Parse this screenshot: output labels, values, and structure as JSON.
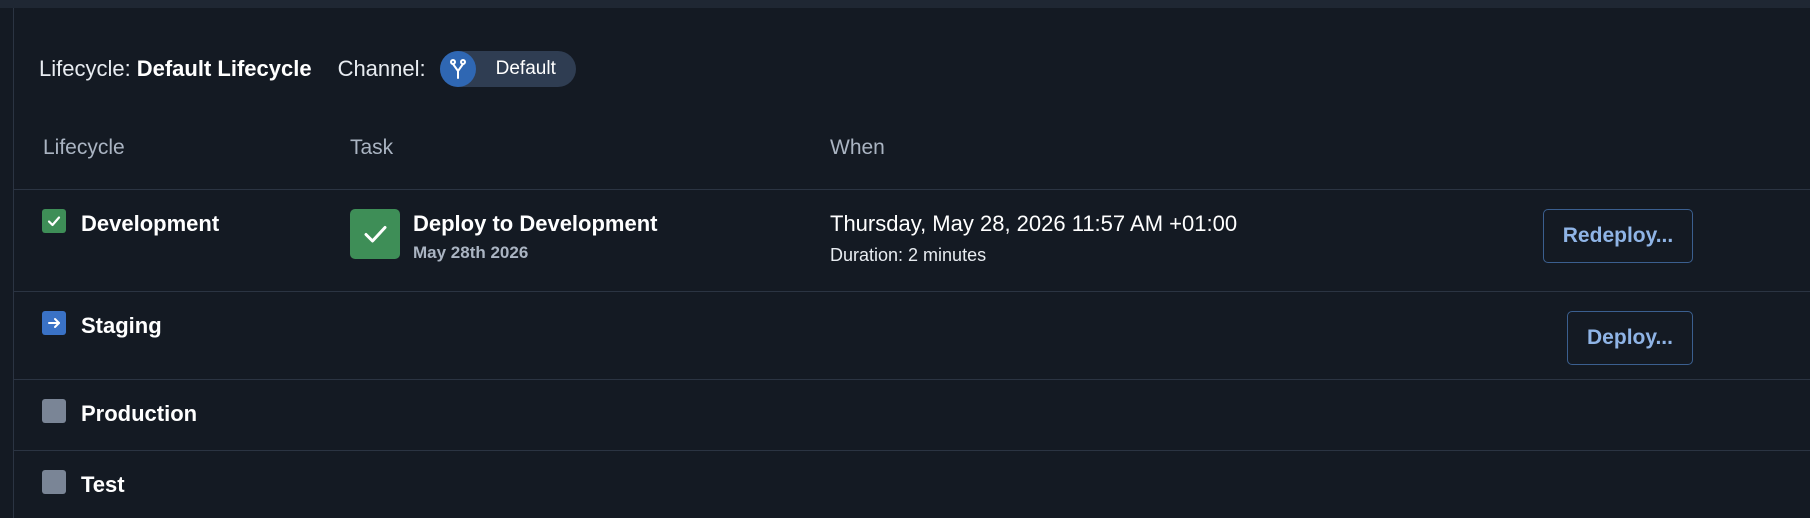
{
  "summary": {
    "lifecycle_label": "Lifecycle:",
    "lifecycle_value": "Default Lifecycle",
    "channel_label": "Channel:",
    "channel_value": "Default",
    "channel_icon": "branch-icon"
  },
  "columns": [
    "Lifecycle",
    "Task",
    "When"
  ],
  "rows": [
    {
      "stage": "Development",
      "status": "done",
      "status_icon": "checkmark-icon",
      "task_title": "Deploy to Development",
      "task_date": "May 28th 2026",
      "when": "Thursday, May 28, 2026 11:57 AM +01:00",
      "duration": "Duration: 2 minutes",
      "action": "Redeploy..."
    },
    {
      "stage": "Staging",
      "status": "next",
      "status_icon": "arrow-right-icon",
      "action": "Deploy..."
    },
    {
      "stage": "Production",
      "status": "todo"
    },
    {
      "stage": "Test",
      "status": "todo"
    }
  ],
  "colors": {
    "background": "#141a23",
    "success": "#3e8e57",
    "next": "#3a72c6",
    "pending": "#7a8596",
    "link": "#8fb4e6"
  }
}
